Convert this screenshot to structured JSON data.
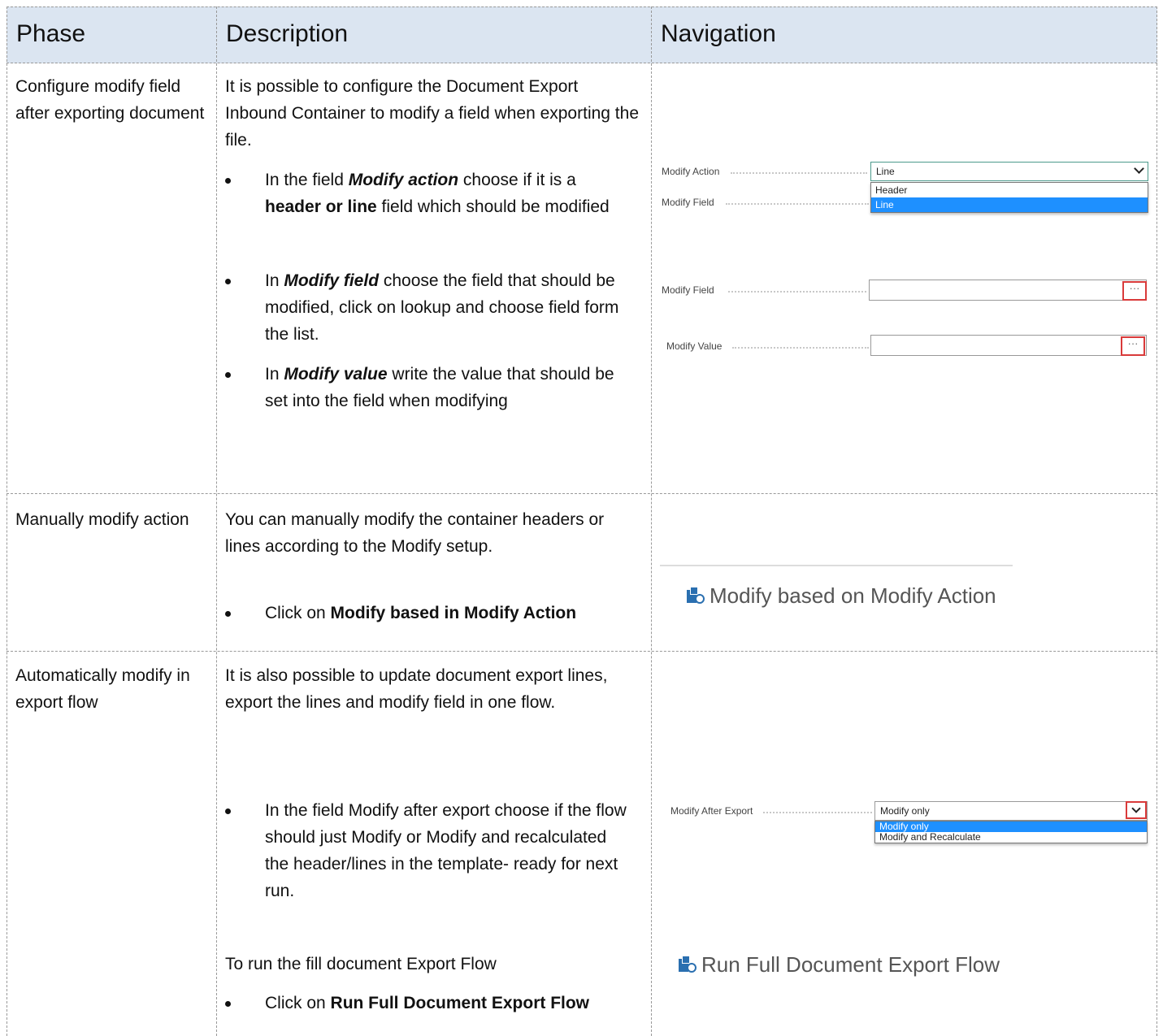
{
  "table": {
    "headers": [
      "Phase",
      "Description",
      "Navigation"
    ]
  },
  "row1": {
    "phase": "Configure modify field after exporting document",
    "intro": "It is possible to configure the Document Export Inbound Container to modify a field when exporting the file.",
    "b1_pre": "In the field ",
    "b1_em": "Modify action",
    "b1_mid": " choose if it is a ",
    "b1_bold": "header or line",
    "b1_post": " field which should be modified",
    "b2_pre": "In ",
    "b2_em": "Modify field",
    "b2_post": " choose the field that should be modified, click on lookup and choose field form the list.",
    "b3_pre": "In ",
    "b3_em": "Modify value",
    "b3_post": " write the value that should be set into the field when modifying",
    "nav": {
      "modify_action_label": "Modify Action",
      "modify_action_value": "Line",
      "options": [
        "Header",
        "Line"
      ],
      "modify_field_label_behind": "Modify Field",
      "modify_field_label": "Modify Field",
      "modify_value_label": "Modify Value",
      "lookup_glyph": "···"
    }
  },
  "row2": {
    "phase": "Manually modify action",
    "intro": "You can manually modify the container headers or lines according to the Modify setup.",
    "b1_pre": "Click on ",
    "b1_bold": "Modify based in Modify Action",
    "nav_action": "Modify based on Modify Action"
  },
  "row3": {
    "phase": "Automatically modify in export flow",
    "intro": "It is also possible to update document export lines, export the lines and modify field in one flow.",
    "b1": "In the field Modify after export choose if the flow should just Modify or Modify and recalculated the header/lines in the template- ready for next run.",
    "run_text": "To run the fill document Export Flow",
    "b2_pre": "Click on ",
    "b2_bold": "Run Full Document Export Flow",
    "nav": {
      "modify_after_label": "Modify After Export",
      "modify_after_value": "Modify only",
      "options": [
        "Modify only",
        "Modify and Recalculate"
      ],
      "run_action": "Run Full Document Export Flow"
    }
  }
}
